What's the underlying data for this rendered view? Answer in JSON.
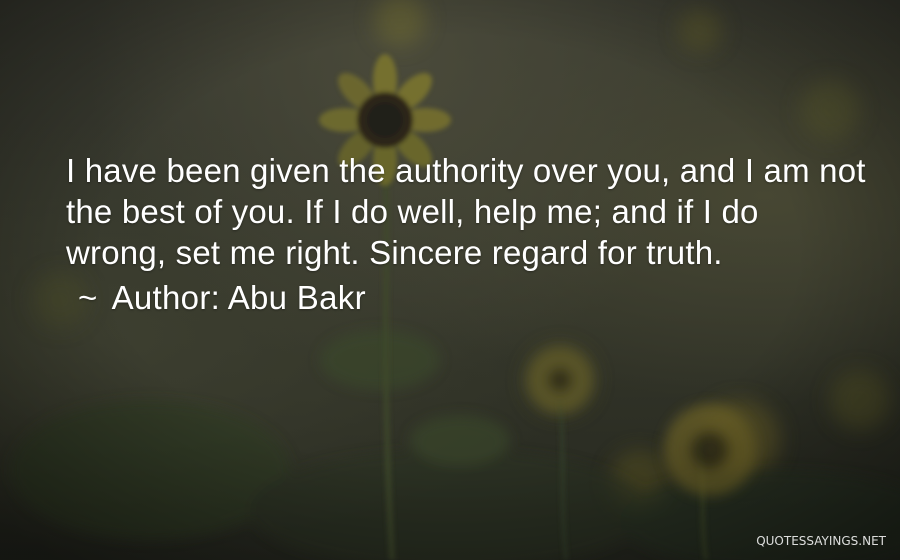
{
  "quote": {
    "text": "I have been given the authority over you, and I am not the best of you. If I do well, help me; and if I do wrong, set me right. Sincere regard for truth.",
    "author_prefix": "~",
    "author_label": "Author: Abu Bakr"
  },
  "watermark": "QUOTESSAYINGS.NET",
  "colors": {
    "text": "#ffffff",
    "background_dark": "#2a2b24",
    "flower_petal": "#6b6a2e",
    "flower_center": "#2a2416",
    "stem": "#3f4a2c"
  }
}
